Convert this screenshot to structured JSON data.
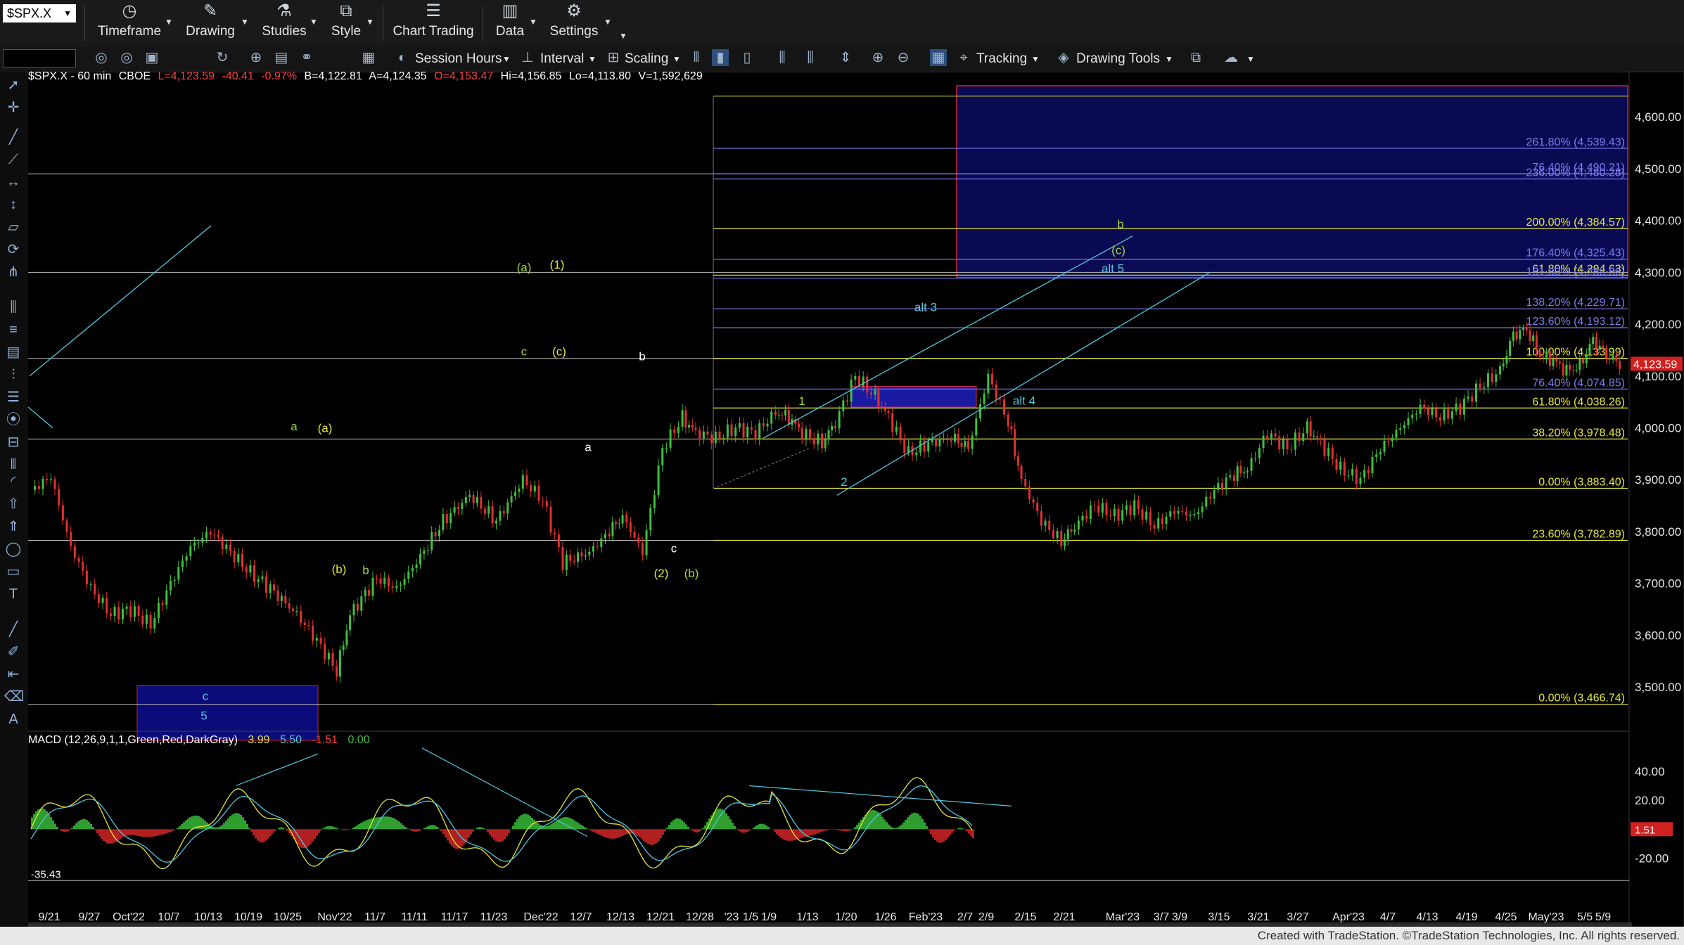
{
  "toolbar": {
    "symbol": "$SPX.X",
    "buttons": [
      {
        "label": "Timeframe",
        "icon": "clock-icon"
      },
      {
        "label": "Drawing",
        "icon": "pen-icon"
      },
      {
        "label": "Studies",
        "icon": "flask-icon"
      },
      {
        "label": "Style",
        "icon": "style-icon"
      },
      {
        "label": "Chart Trading",
        "icon": "chart-trading-icon"
      },
      {
        "label": "Data",
        "icon": "data-icon"
      },
      {
        "label": "Settings",
        "icon": "gear-icon"
      }
    ],
    "row2": {
      "session_hours": "Session Hours",
      "interval": "Interval",
      "scaling": "Scaling",
      "tracking": "Tracking",
      "drawing_tools": "Drawing Tools"
    }
  },
  "info": {
    "symbol_line": "$SPX.X - 60 min",
    "exchange": "CBOE",
    "last": "L=4,123.59",
    "change": "-40.41",
    "pct": "-0.97%",
    "bid": "B=4,122.81",
    "ask": "A=4,124.35",
    "open": "O=4,153.47",
    "high": "Hi=4,156.85",
    "low": "Lo=4,113.80",
    "volume": "V=1,592,629"
  },
  "macd_info": {
    "label": "MACD (12,26,9,1,1,Green,Red,DarkGray)",
    "v1": "3.99",
    "v2": "5.50",
    "v3": "-1.51",
    "v4": "0.00"
  },
  "footer": {
    "credit": "Created with TradeStation. ©TradeStation Technologies, Inc. All rights reserved."
  },
  "colors": {
    "up": "#3fbf3f",
    "down": "#e03030",
    "fib_yellow": "#e6e63c",
    "fib_blue": "#7b7bf0",
    "cyan": "#4fc8e0",
    "box_blue": "#0b0b7a"
  },
  "chart_data": {
    "type": "candlestick",
    "symbol": "$SPX.X",
    "interval": "60 min",
    "ylim": [
      3420,
      4660
    ],
    "y_ticks": [
      "4,600.00",
      "4,500.00",
      "4,400.00",
      "4,300.00",
      "4,200.00",
      "4,100.00",
      "4,000.00",
      "3,900.00",
      "3,800.00",
      "3,700.00",
      "3,600.00",
      "3,500.00"
    ],
    "y_tick_values": [
      4600,
      4500,
      4400,
      4300,
      4200,
      4100,
      4000,
      3900,
      3800,
      3700,
      3600,
      3500
    ],
    "x_ticks": [
      "9/21",
      "9/27",
      "Oct'22",
      "10/7",
      "10/13",
      "10/19",
      "10/25",
      "Nov'22",
      "11/7",
      "11/11",
      "11/17",
      "11/23",
      "Dec'22",
      "12/7",
      "12/13",
      "12/21",
      "12/28",
      "'23",
      "1/5",
      "1/9",
      "1/13",
      "1/20",
      "1/26",
      "Feb'23",
      "2/7",
      "2/9",
      "2/15",
      "2/21",
      "Mar'23",
      "3/7",
      "3/9",
      "3/15",
      "3/21",
      "3/27",
      "Apr'23",
      "4/7",
      "4/13",
      "4/19",
      "4/25",
      "May'23",
      "5/5",
      "5/9"
    ],
    "price_path": [
      [
        0,
        3880
      ],
      [
        3,
        3905
      ],
      [
        6,
        3770
      ],
      [
        9,
        3690
      ],
      [
        12,
        3640
      ],
      [
        15,
        3650
      ],
      [
        18,
        3620
      ],
      [
        21,
        3700
      ],
      [
        24,
        3770
      ],
      [
        27,
        3800
      ],
      [
        30,
        3760
      ],
      [
        33,
        3720
      ],
      [
        36,
        3690
      ],
      [
        40,
        3640
      ],
      [
        43,
        3590
      ],
      [
        46,
        3530
      ],
      [
        48,
        3640
      ],
      [
        52,
        3710
      ],
      [
        55,
        3690
      ],
      [
        58,
        3740
      ],
      [
        62,
        3820
      ],
      [
        66,
        3870
      ],
      [
        70,
        3820
      ],
      [
        74,
        3900
      ],
      [
        77,
        3860
      ],
      [
        80,
        3740
      ],
      [
        84,
        3760
      ],
      [
        87,
        3800
      ],
      [
        89,
        3830
      ],
      [
        92,
        3760
      ],
      [
        95,
        3960
      ],
      [
        98,
        4020
      ],
      [
        100,
        3990
      ],
      [
        103,
        3980
      ],
      [
        106,
        4000
      ],
      [
        109,
        3990
      ],
      [
        112,
        4030
      ],
      [
        114,
        4020
      ],
      [
        116,
        3990
      ],
      [
        119,
        3970
      ],
      [
        121,
        4010
      ],
      [
        124,
        4100
      ],
      [
        127,
        4060
      ],
      [
        129,
        4020
      ],
      [
        132,
        3950
      ],
      [
        135,
        3970
      ],
      [
        139,
        3980
      ],
      [
        141,
        3960
      ],
      [
        144,
        4100
      ],
      [
        147,
        4010
      ],
      [
        149,
        3900
      ],
      [
        152,
        3820
      ],
      [
        155,
        3780
      ],
      [
        157,
        3810
      ],
      [
        160,
        3850
      ],
      [
        163,
        3830
      ],
      [
        166,
        3850
      ],
      [
        169,
        3810
      ],
      [
        172,
        3840
      ],
      [
        175,
        3830
      ],
      [
        178,
        3880
      ],
      [
        181,
        3910
      ],
      [
        183,
        3920
      ],
      [
        186,
        3990
      ],
      [
        189,
        3960
      ],
      [
        192,
        4000
      ],
      [
        194,
        3970
      ],
      [
        197,
        3920
      ],
      [
        200,
        3900
      ],
      [
        203,
        3960
      ],
      [
        206,
        4000
      ],
      [
        209,
        4040
      ],
      [
        212,
        4020
      ],
      [
        215,
        4040
      ],
      [
        218,
        4080
      ],
      [
        221,
        4110
      ],
      [
        223,
        4180
      ],
      [
        225,
        4190
      ],
      [
        227,
        4140
      ],
      [
        229,
        4130
      ],
      [
        231,
        4110
      ],
      [
        233,
        4120
      ],
      [
        235,
        4170
      ],
      [
        237,
        4140
      ],
      [
        239,
        4124
      ]
    ],
    "bars_total_slots": 239,
    "fib_levels": [
      {
        "label": "261.80% (4,539.43)",
        "value": 4539.43,
        "color": "#7b7bf0"
      },
      {
        "label": "76.40% (4,490.21)",
        "value": 4490.21,
        "color": "#7b7bf0"
      },
      {
        "label": "236.00% (4,480.28)",
        "value": 4480.28,
        "color": "#7b7bf0"
      },
      {
        "label": "200.00% (4,384.57)",
        "value": 4384.57,
        "color": "#e6e63c"
      },
      {
        "label": "176.40% (4,325.43)",
        "value": 4325.43,
        "color": "#7b7bf0"
      },
      {
        "label": "61.80% (4,294.63)",
        "value": 4294.63,
        "color": "#e6e63c"
      },
      {
        "label": "161.80% (4,288.86)",
        "value": 4288.86,
        "color": "#7b7bf0"
      },
      {
        "label": "138.20% (4,229.71)",
        "value": 4229.71,
        "color": "#7b7bf0"
      },
      {
        "label": "123.60% (4,193.12)",
        "value": 4193.12,
        "color": "#7b7bf0"
      },
      {
        "label": "100.00% (4,133.99)",
        "value": 4133.99,
        "color": "#e6e63c"
      },
      {
        "label": "76.40% (4,074.85)",
        "value": 4074.85,
        "color": "#7b7bf0"
      },
      {
        "label": "61.80% (4,038.26)",
        "value": 4038.26,
        "color": "#e6e63c"
      },
      {
        "label": "38.20% (3,978.48)",
        "value": 3978.48,
        "color": "#e6e63c"
      },
      {
        "label": "0.00% (3,883.40)",
        "value": 3883.4,
        "color": "#e6e63c"
      },
      {
        "label": "23.60% (3,782.89)",
        "value": 3782.89,
        "color": "#e6e63c"
      },
      {
        "label": "0.00% (3,466.74)",
        "value": 3466.74,
        "color": "#e6e63c"
      }
    ],
    "current_price_label": "4,123.59",
    "macd_ticks": [
      "40.00",
      "20.00",
      "-20.00"
    ],
    "macd_tick_values": [
      40,
      20,
      -20
    ],
    "macd_ylim": [
      -45,
      55
    ],
    "macd_low_label": "-35.43",
    "macd_current_label": "1.51",
    "wave_labels": [
      {
        "text": "(a)",
        "color": "#9fd63a"
      },
      {
        "text": "(1)",
        "color": "#e6e63c"
      },
      {
        "text": "c",
        "color": "#9fd63a"
      },
      {
        "text": "(c)",
        "color": "#e6e63c"
      },
      {
        "text": "b",
        "color": "#ffffff"
      },
      {
        "text": "a",
        "color": "#ffffff"
      },
      {
        "text": "a",
        "color": "#9fd63a"
      },
      {
        "text": "(a)",
        "color": "#e6e63c"
      },
      {
        "text": "(b)",
        "color": "#e6e63c"
      },
      {
        "text": "b",
        "color": "#9fd63a"
      },
      {
        "text": "c",
        "color": "#ffffff"
      },
      {
        "text": "(2)",
        "color": "#e6e63c"
      },
      {
        "text": "(b)",
        "color": "#9fd63a"
      },
      {
        "text": "c",
        "color": "#4fc8e0"
      },
      {
        "text": "5",
        "color": "#4fc8e0"
      },
      {
        "text": "1",
        "color": "#9fd63a"
      },
      {
        "text": "2",
        "color": "#4fc8e0"
      },
      {
        "text": "alt 3",
        "color": "#4fc8e0"
      },
      {
        "text": "alt 4",
        "color": "#4fc8e0"
      },
      {
        "text": "alt 5",
        "color": "#4fc8e0"
      },
      {
        "text": "b",
        "color": "#9fd63a"
      },
      {
        "text": "(c)",
        "color": "#9fd63a"
      }
    ]
  }
}
